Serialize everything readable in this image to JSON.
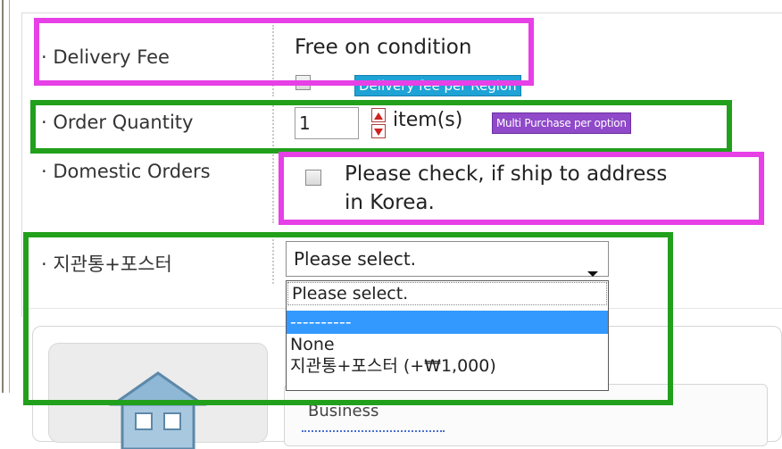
{
  "rows": {
    "delivery": {
      "label": "· Delivery Fee",
      "value": "Free on condition",
      "region_badge": "Delivery fee per Region"
    },
    "quantity": {
      "label": "· Order Quantity",
      "value": "1",
      "unit": "item(s)",
      "multi_badge": "Multi Purchase per option"
    },
    "domestic": {
      "label": "· Domestic Orders",
      "check_text_line1": "Please check, if ship to address",
      "check_text_line2": "in Korea."
    },
    "option": {
      "label": "· 지관통+포스터",
      "selected": "Please select."
    }
  },
  "dropdown": {
    "options": [
      "Please select.",
      "----------",
      "None",
      "지관통+포스터 (+₩1,000)"
    ],
    "highlighted_index": 1
  },
  "lower_panel": {
    "business_text": "Business"
  },
  "colors": {
    "pink_highlight": "#e640e6",
    "green_highlight": "#22a01c",
    "badge_blue": "#1fa2d6",
    "badge_purple": "#8f49c9",
    "selection": "#3399ff"
  }
}
